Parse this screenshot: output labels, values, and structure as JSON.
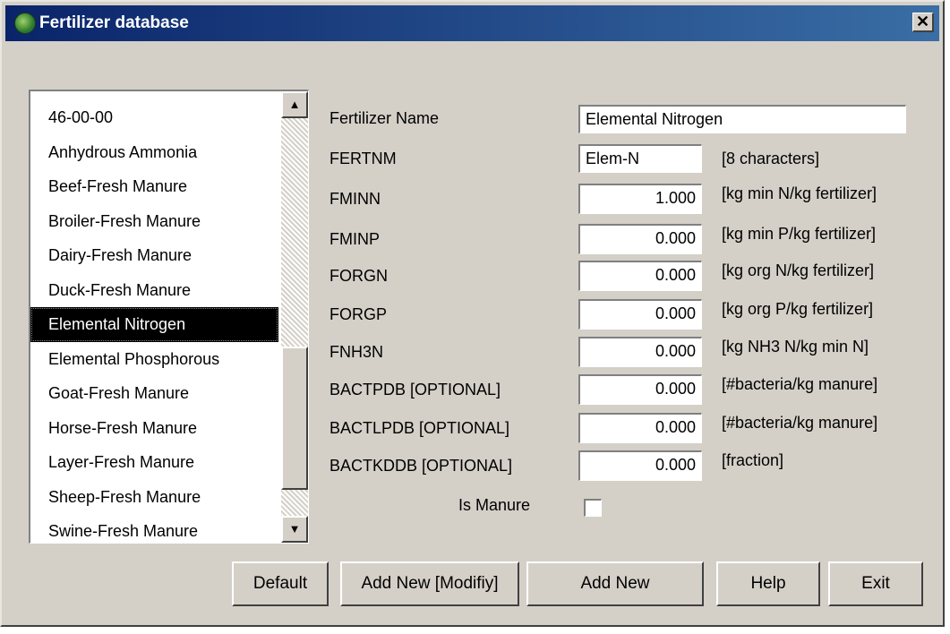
{
  "window": {
    "title": "Fertilizer database",
    "close_glyph": "✕"
  },
  "list": {
    "items": [
      "46-00-00",
      "Anhydrous Ammonia",
      "Beef-Fresh Manure",
      "Broiler-Fresh Manure",
      "Dairy-Fresh Manure",
      "Duck-Fresh Manure",
      "Elemental Nitrogen",
      "Elemental Phosphorous",
      "Goat-Fresh Manure",
      "Horse-Fresh Manure",
      "Layer-Fresh Manure",
      "Sheep-Fresh Manure",
      "Swine-Fresh Manure"
    ],
    "selected": "Elemental Nitrogen",
    "up_glyph": "▲",
    "down_glyph": "▼"
  },
  "form": {
    "name": {
      "label": "Fertilizer Name",
      "value": "Elemental Nitrogen"
    },
    "fertnm": {
      "label": "FERTNM",
      "value": "Elem-N",
      "unit": "[8 characters]"
    },
    "rows": [
      {
        "label": "FMINN",
        "value": "1.000",
        "unit": "[kg min N/kg fertilizer]"
      },
      {
        "label": "FMINP",
        "value": "0.000",
        "unit": "[kg min P/kg fertilizer]"
      },
      {
        "label": "FORGN",
        "value": "0.000",
        "unit": "[kg org N/kg fertilizer]"
      },
      {
        "label": "FORGP",
        "value": "0.000",
        "unit": "[kg org P/kg fertilizer]"
      },
      {
        "label": "FNH3N",
        "value": "0.000",
        "unit": "[kg NH3  N/kg min N]"
      },
      {
        "label": "BACTPDB [OPTIONAL]",
        "value": "0.000",
        "unit": "[#bacteria/kg manure]"
      },
      {
        "label": "BACTLPDB [OPTIONAL]",
        "value": "0.000",
        "unit": "[#bacteria/kg manure]"
      },
      {
        "label": "BACTKDDB [OPTIONAL]",
        "value": "0.000",
        "unit": "[fraction]"
      }
    ],
    "is_manure": {
      "label": "Is Manure",
      "checked": false
    }
  },
  "buttons": {
    "default": "Default",
    "add_modify": "Add New [Modifiy]",
    "add_new": "Add New",
    "help": "Help",
    "exit": "Exit"
  }
}
